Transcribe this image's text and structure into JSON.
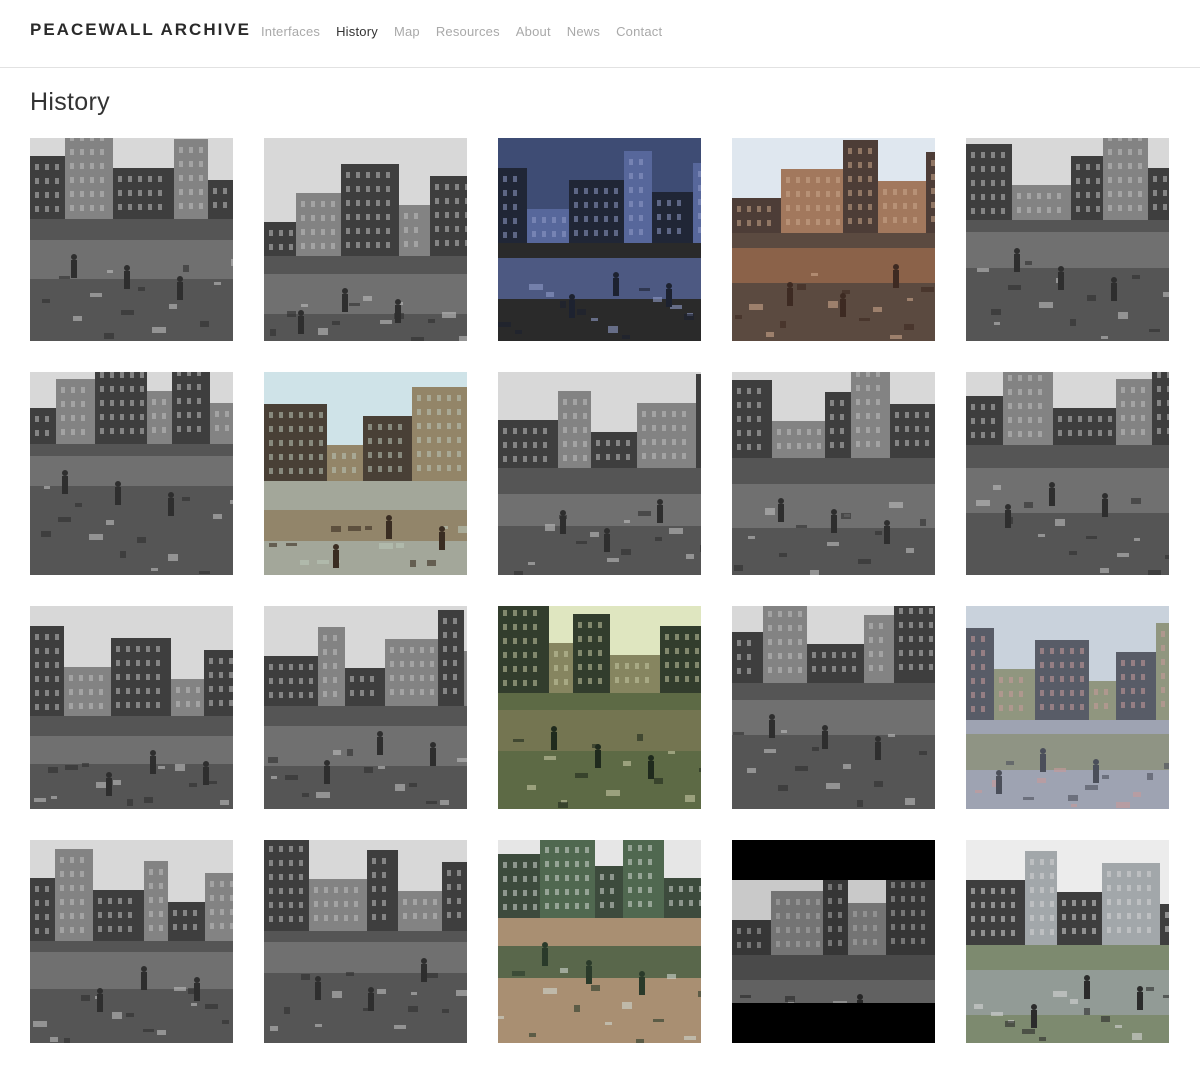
{
  "site": {
    "title": "PEACEWALL ARCHIVE"
  },
  "nav": {
    "items": [
      {
        "label": "Interfaces",
        "active": false
      },
      {
        "label": "History",
        "active": true
      },
      {
        "label": "Map",
        "active": false
      },
      {
        "label": "Resources",
        "active": false
      },
      {
        "label": "About",
        "active": false
      },
      {
        "label": "News",
        "active": false
      },
      {
        "label": "Contact",
        "active": false
      }
    ]
  },
  "page": {
    "title": "History"
  },
  "gallery": {
    "photos": [
      {
        "name": "photo-workers-building-wall-funeral-parlour",
        "palette": "bw"
      },
      {
        "name": "photo-terraced-street-vans",
        "palette": "bw"
      },
      {
        "name": "photo-man-climbing-corrugated-fence",
        "palette": "color-blue"
      },
      {
        "name": "photo-derelict-street-red-brick-building",
        "palette": "color-warm"
      },
      {
        "name": "photo-rubble-terraced-houses",
        "palette": "bw"
      },
      {
        "name": "photo-barricade-graffiti-wall",
        "palette": "bw"
      },
      {
        "name": "photo-barrels-barricade-street",
        "palette": "color-green"
      },
      {
        "name": "photo-barbed-wire-barricade",
        "palette": "bw"
      },
      {
        "name": "photo-street-mother-pram",
        "palette": "bw"
      },
      {
        "name": "photo-corrugated-wall-terraces",
        "palette": "bw"
      },
      {
        "name": "photo-collage-street-scenes",
        "palette": "bw"
      },
      {
        "name": "photo-demolished-site-wall",
        "palette": "bw"
      },
      {
        "name": "photo-metal-gate-alley",
        "palette": "color-olive"
      },
      {
        "name": "photo-hillside-wall-estate",
        "palette": "bw"
      },
      {
        "name": "photo-aerial-wall-city-hills",
        "palette": "color-pastel"
      },
      {
        "name": "photo-children-running-by-wall",
        "palette": "bw"
      },
      {
        "name": "photo-derelict-houses-yard",
        "palette": "bw"
      },
      {
        "name": "photo-long-wall-field",
        "palette": "color-field"
      },
      {
        "name": "photo-lone-house-before-wall",
        "palette": "bw-frame"
      },
      {
        "name": "photo-tall-fence-posts-gate",
        "palette": "color-grey"
      }
    ]
  }
}
